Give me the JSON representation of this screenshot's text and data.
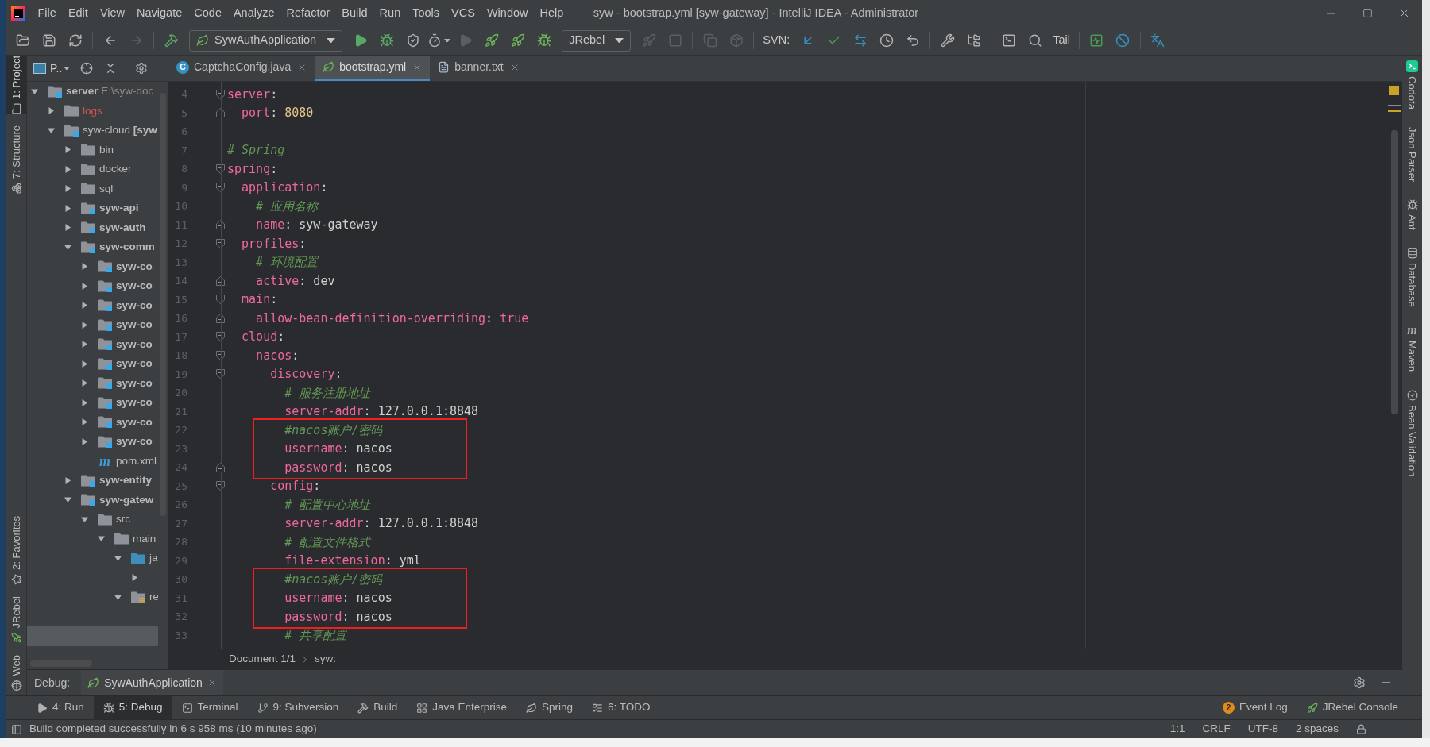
{
  "menu_bar": {
    "items": [
      "File",
      "Edit",
      "View",
      "Navigate",
      "Code",
      "Analyze",
      "Refactor",
      "Build",
      "Run",
      "Tools",
      "VCS",
      "Window",
      "Help"
    ],
    "title": "syw - bootstrap.yml [syw-gateway] - IntelliJ IDEA - Administrator"
  },
  "toolbar": {
    "groups": [
      {
        "items": [
          {
            "kind": "icon",
            "disabled": false
          },
          {
            "kind": "icon",
            "disabled": false
          },
          {
            "kind": "icon",
            "disabled": false
          }
        ]
      },
      {
        "items": [
          {
            "kind": "icon",
            "disabled": false
          },
          {
            "kind": "icon",
            "disabled": true
          }
        ]
      },
      {
        "items": [
          {
            "kind": "icon",
            "disabled": false
          },
          {
            "kind": "dropdown",
            "label": "SywAuthApplication"
          },
          {
            "kind": "icon",
            "disabled": false
          },
          {
            "kind": "icon",
            "disabled": false
          },
          {
            "kind": "icon",
            "disabled": false
          },
          {
            "kind": "icon",
            "disabled": false
          },
          {
            "kind": "icon",
            "disabled": true
          },
          {
            "kind": "icon",
            "disabled": false
          },
          {
            "kind": "icon",
            "disabled": false
          },
          {
            "kind": "icon",
            "disabled": false
          },
          {
            "kind": "dropdown",
            "label": "JRebel"
          },
          {
            "kind": "icon",
            "disabled": true
          },
          {
            "kind": "icon",
            "disabled": true
          }
        ]
      },
      {
        "items": [
          {
            "kind": "icon",
            "disabled": true
          },
          {
            "kind": "icon",
            "disabled": true
          }
        ]
      },
      {
        "items": [
          {
            "kind": "label",
            "text": "SVN:"
          },
          {
            "kind": "icon",
            "disabled": false
          },
          {
            "kind": "icon",
            "disabled": false
          },
          {
            "kind": "icon",
            "disabled": false
          },
          {
            "kind": "icon",
            "disabled": false
          },
          {
            "kind": "icon",
            "disabled": false
          }
        ]
      },
      {
        "items": [
          {
            "kind": "icon",
            "disabled": false
          },
          {
            "kind": "icon",
            "disabled": false
          }
        ]
      },
      {
        "items": [
          {
            "kind": "icon",
            "disabled": false
          },
          {
            "kind": "icon",
            "disabled": false
          },
          {
            "kind": "button",
            "label": "Tail"
          }
        ]
      },
      {
        "items": [
          {
            "kind": "icon",
            "disabled": false
          },
          {
            "kind": "icon",
            "disabled": false
          }
        ]
      },
      {
        "items": [
          {
            "kind": "icon",
            "disabled": false
          }
        ]
      }
    ]
  },
  "left_tool_strip": {
    "top": [
      {
        "label": "1: Project",
        "selected": true
      },
      {
        "label": "7: Structure",
        "selected": false
      }
    ],
    "bottom": [
      {
        "label": "2: Favorites",
        "selected": false
      },
      {
        "label": "JRebel",
        "selected": false
      },
      {
        "label": "Web",
        "selected": false
      }
    ]
  },
  "project_panel": {
    "view_label": "P..",
    "tree": [
      {
        "name": "server",
        "path": "E:\\syw-doc",
        "kind": "module",
        "expanded": true,
        "selected": false,
        "children": [
          {
            "name": "logs",
            "kind": "excluded",
            "expanded": false,
            "selected": false
          },
          {
            "name": "syw-cloud",
            "module_name": "[syw",
            "kind": "module",
            "expanded": true,
            "selected": false,
            "children": [
              {
                "name": "bin",
                "kind": "folder",
                "expanded": false,
                "selected": false
              },
              {
                "name": "docker",
                "kind": "folder",
                "expanded": false,
                "selected": false
              },
              {
                "name": "sql",
                "kind": "folder",
                "expanded": false,
                "selected": false
              },
              {
                "name": "syw-api",
                "kind": "module",
                "expanded": false,
                "selected": false
              },
              {
                "name": "syw-auth",
                "kind": "module",
                "expanded": false,
                "selected": false
              },
              {
                "name": "syw-comm",
                "kind": "module",
                "expanded": true,
                "selected": false,
                "children": [
                  {
                    "name": "syw-co",
                    "kind": "module",
                    "expanded": false,
                    "selected": false
                  },
                  {
                    "name": "syw-co",
                    "kind": "module",
                    "expanded": false,
                    "selected": false
                  },
                  {
                    "name": "syw-co",
                    "kind": "module",
                    "expanded": false,
                    "selected": false
                  },
                  {
                    "name": "syw-co",
                    "kind": "module",
                    "expanded": false,
                    "selected": false
                  },
                  {
                    "name": "syw-co",
                    "kind": "module",
                    "expanded": false,
                    "selected": false
                  },
                  {
                    "name": "syw-co",
                    "kind": "module",
                    "expanded": false,
                    "selected": false
                  },
                  {
                    "name": "syw-co",
                    "kind": "module",
                    "expanded": false,
                    "selected": false
                  },
                  {
                    "name": "syw-co",
                    "kind": "module",
                    "expanded": false,
                    "selected": false
                  },
                  {
                    "name": "syw-co",
                    "kind": "module",
                    "expanded": false,
                    "selected": false
                  },
                  {
                    "name": "syw-co",
                    "kind": "module",
                    "expanded": false,
                    "selected": false
                  },
                  {
                    "name": "pom.xml",
                    "kind": "maven",
                    "glyph": "m",
                    "selected": false
                  }
                ]
              },
              {
                "name": "syw-entity",
                "kind": "module",
                "expanded": false,
                "selected": false
              },
              {
                "name": "syw-gatew",
                "kind": "module",
                "expanded": true,
                "selected": false,
                "children": [
                  {
                    "name": "src",
                    "kind": "folder",
                    "expanded": true,
                    "selected": false,
                    "children": [
                      {
                        "name": "main",
                        "kind": "folder",
                        "expanded": true,
                        "selected": false,
                        "children": [
                          {
                            "name": "ja",
                            "kind": "source",
                            "expanded": true,
                            "selected": false,
                            "children": [
                              {
                                "expanded": false,
                                "selected": false
                              }
                            ]
                          },
                          {
                            "name": "re",
                            "kind": "resources",
                            "expanded": true,
                            "selected": false,
                            "children": [
                              {
                                "selected": false
                              },
                              {
                                "selected": true
                              }
                            ]
                          }
                        ]
                      }
                    ]
                  }
                ]
              }
            ]
          }
        ]
      }
    ]
  },
  "editor": {
    "tabs": [
      {
        "label": "CaptchaConfig.java",
        "glyph": "C",
        "selected": false
      },
      {
        "label": "bootstrap.yml",
        "selected": true
      },
      {
        "label": "banner.txt",
        "selected": false
      }
    ],
    "lines": [
      {
        "number": "4",
        "fold_start": true,
        "tokens": [
          {
            "kind": "key",
            "text": "server"
          },
          {
            "kind": "punct",
            "text": ":"
          }
        ],
        "children": [
          {
            "number": "5",
            "fold_end": true,
            "tokens": [
              {
                "kind": "key",
                "text": "port"
              },
              {
                "kind": "punct",
                "text": ": "
              },
              {
                "kind": "number",
                "text": "8080"
              }
            ]
          }
        ]
      },
      {
        "number": "6"
      },
      {
        "number": "7",
        "tokens": [
          {
            "kind": "comment",
            "text": "# Spring"
          }
        ]
      },
      {
        "number": "8",
        "fold_start": true,
        "tokens": [
          {
            "kind": "key",
            "text": "spring"
          },
          {
            "kind": "punct",
            "text": ":"
          }
        ],
        "children": [
          {
            "number": "9",
            "fold_start": true,
            "tokens": [
              {
                "kind": "key",
                "text": "application"
              },
              {
                "kind": "punct",
                "text": ":"
              }
            ],
            "children": [
              {
                "number": "10",
                "tokens": [
                  {
                    "kind": "comment",
                    "text": "# 应用名称"
                  }
                ]
              },
              {
                "number": "11",
                "fold_end": true,
                "tokens": [
                  {
                    "kind": "key",
                    "text": "name"
                  },
                  {
                    "kind": "punct",
                    "text": ": "
                  },
                  {
                    "kind": "value",
                    "text": "syw-gateway"
                  }
                ]
              }
            ]
          },
          {
            "number": "12",
            "fold_start": true,
            "tokens": [
              {
                "kind": "key",
                "text": "profiles"
              },
              {
                "kind": "punct",
                "text": ":"
              }
            ],
            "children": [
              {
                "number": "13",
                "tokens": [
                  {
                    "kind": "comment",
                    "text": "# 环境配置"
                  }
                ]
              },
              {
                "number": "14",
                "fold_end": true,
                "tokens": [
                  {
                    "kind": "key",
                    "text": "active"
                  },
                  {
                    "kind": "punct",
                    "text": ": "
                  },
                  {
                    "kind": "value",
                    "text": "dev"
                  }
                ]
              }
            ]
          },
          {
            "number": "15",
            "fold_start": true,
            "tokens": [
              {
                "kind": "key",
                "text": "main"
              },
              {
                "kind": "punct",
                "text": ":"
              }
            ],
            "children": [
              {
                "number": "16",
                "fold_end": true,
                "tokens": [
                  {
                    "kind": "key",
                    "text": "allow-bean-definition-overriding"
                  },
                  {
                    "kind": "punct",
                    "text": ": "
                  },
                  {
                    "kind": "boolean",
                    "text": "true"
                  }
                ]
              }
            ]
          },
          {
            "number": "17",
            "fold_start": true,
            "tokens": [
              {
                "kind": "key",
                "text": "cloud"
              },
              {
                "kind": "punct",
                "text": ":"
              }
            ],
            "children": [
              {
                "number": "18",
                "fold_start": true,
                "tokens": [
                  {
                    "kind": "key",
                    "text": "nacos"
                  },
                  {
                    "kind": "punct",
                    "text": ":"
                  }
                ],
                "children": [
                  {
                    "number": "19",
                    "fold_start": true,
                    "tokens": [
                      {
                        "kind": "key",
                        "text": "discovery"
                      },
                      {
                        "kind": "punct",
                        "text": ":"
                      }
                    ],
                    "children": [
                      {
                        "number": "20",
                        "tokens": [
                          {
                            "kind": "comment",
                            "text": "# 服务注册地址"
                          }
                        ]
                      },
                      {
                        "number": "21",
                        "tokens": [
                          {
                            "kind": "key",
                            "text": "server-addr"
                          },
                          {
                            "kind": "punct",
                            "text": ": "
                          },
                          {
                            "kind": "value",
                            "text": "127.0.0.1:8848"
                          }
                        ]
                      },
                      {
                        "number": "22",
                        "boxed": true,
                        "tokens": [
                          {
                            "kind": "comment",
                            "text": "#nacos账户/密码"
                          }
                        ]
                      },
                      {
                        "number": "23",
                        "boxed": true,
                        "tokens": [
                          {
                            "kind": "key",
                            "text": "username"
                          },
                          {
                            "kind": "punct",
                            "text": ": "
                          },
                          {
                            "kind": "value",
                            "text": "nacos"
                          }
                        ]
                      },
                      {
                        "number": "24",
                        "boxed": true,
                        "fold_end": true,
                        "tokens": [
                          {
                            "kind": "key",
                            "text": "password"
                          },
                          {
                            "kind": "punct",
                            "text": ": "
                          },
                          {
                            "kind": "value",
                            "text": "nacos"
                          }
                        ]
                      }
                    ]
                  },
                  {
                    "number": "25",
                    "fold_start": true,
                    "tokens": [
                      {
                        "kind": "key",
                        "text": "config"
                      },
                      {
                        "kind": "punct",
                        "text": ":"
                      }
                    ],
                    "children": [
                      {
                        "number": "26",
                        "tokens": [
                          {
                            "kind": "comment",
                            "text": "# 配置中心地址"
                          }
                        ]
                      },
                      {
                        "number": "27",
                        "tokens": [
                          {
                            "kind": "key",
                            "text": "server-addr"
                          },
                          {
                            "kind": "punct",
                            "text": ": "
                          },
                          {
                            "kind": "value",
                            "text": "127.0.0.1:8848"
                          }
                        ]
                      },
                      {
                        "number": "28",
                        "tokens": [
                          {
                            "kind": "comment",
                            "text": "# 配置文件格式"
                          }
                        ]
                      },
                      {
                        "number": "29",
                        "tokens": [
                          {
                            "kind": "key",
                            "text": "file-extension"
                          },
                          {
                            "kind": "punct",
                            "text": ": "
                          },
                          {
                            "kind": "value",
                            "text": "yml"
                          }
                        ]
                      },
                      {
                        "number": "30",
                        "boxed": true,
                        "tokens": [
                          {
                            "kind": "comment",
                            "text": "#nacos账户/密码"
                          }
                        ]
                      },
                      {
                        "number": "31",
                        "boxed": true,
                        "tokens": [
                          {
                            "kind": "key",
                            "text": "username"
                          },
                          {
                            "kind": "punct",
                            "text": ": "
                          },
                          {
                            "kind": "value",
                            "text": "nacos"
                          }
                        ]
                      },
                      {
                        "number": "32",
                        "boxed": true,
                        "tokens": [
                          {
                            "kind": "key",
                            "text": "password"
                          },
                          {
                            "kind": "punct",
                            "text": ": "
                          },
                          {
                            "kind": "value",
                            "text": "nacos"
                          }
                        ]
                      },
                      {
                        "number": "33",
                        "tokens": [
                          {
                            "kind": "comment",
                            "text": "# 共享配置"
                          }
                        ]
                      }
                    ]
                  }
                ]
              }
            ]
          }
        ]
      }
    ],
    "breadcrumb": [
      "Document 1/1",
      "syw:"
    ]
  },
  "right_tool_strip": [
    {
      "label": "Codota",
      "selected": false
    },
    {
      "label": "Json Parser",
      "selected": false
    },
    {
      "label": "Ant",
      "selected": false
    },
    {
      "label": "Database",
      "selected": false
    },
    {
      "label": "Maven",
      "glyph": "m",
      "selected": false
    },
    {
      "label": "Bean Validation",
      "selected": false
    }
  ],
  "debug_panel": {
    "title": "Debug:",
    "tabs": [
      {
        "label": "SywAuthApplication",
        "selected": true
      }
    ]
  },
  "bottom_tool_bar": {
    "left": [
      {
        "label": "4: Run",
        "selected": false
      },
      {
        "label": "5: Debug",
        "selected": true
      },
      {
        "label": "Terminal",
        "selected": false
      },
      {
        "label": "9: Subversion",
        "selected": false
      },
      {
        "label": "Build",
        "selected": false
      },
      {
        "label": "Java Enterprise",
        "selected": false
      },
      {
        "label": "Spring",
        "selected": false
      },
      {
        "label": "6: TODO",
        "selected": false
      }
    ],
    "right": [
      {
        "label": "Event Log",
        "badge": "2"
      },
      {
        "label": "JRebel Console"
      }
    ]
  },
  "status_bar": {
    "message": "Build completed successfully in 6 s 958 ms (10 minutes ago)",
    "items": [
      "1:1",
      "CRLF",
      "UTF-8",
      "2 spaces"
    ]
  }
}
